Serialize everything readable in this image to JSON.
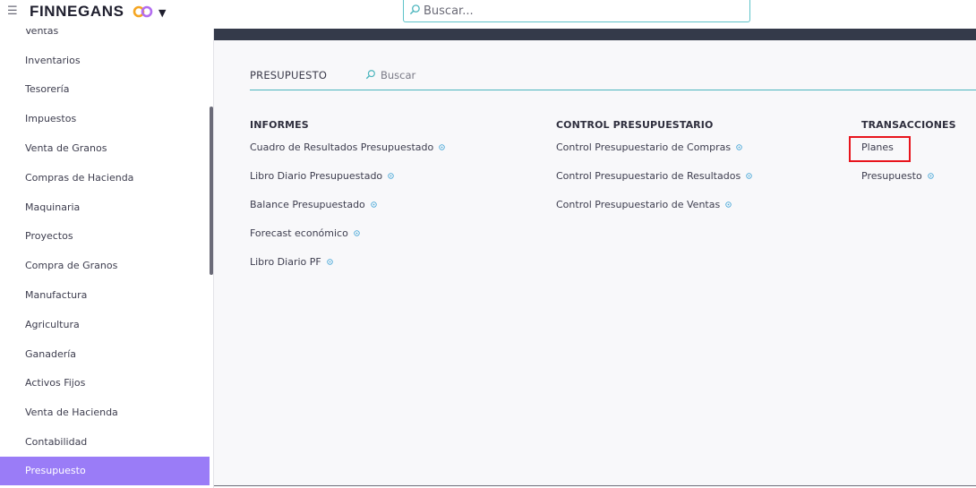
{
  "header": {
    "brand": "FINNEGANS",
    "brand_logo_colors": [
      "#f5a623",
      "#b36ef0"
    ],
    "search_placeholder": "Buscar..."
  },
  "sidebar": {
    "items": [
      {
        "label": "Ventas",
        "active": false
      },
      {
        "label": "Inventarios",
        "active": false
      },
      {
        "label": "Tesorería",
        "active": false
      },
      {
        "label": "Impuestos",
        "active": false
      },
      {
        "label": "Venta de Granos",
        "active": false
      },
      {
        "label": "Compras de Hacienda",
        "active": false
      },
      {
        "label": "Maquinaria",
        "active": false
      },
      {
        "label": "Proyectos",
        "active": false
      },
      {
        "label": "Compra de Granos",
        "active": false
      },
      {
        "label": "Manufactura",
        "active": false
      },
      {
        "label": "Agricultura",
        "active": false
      },
      {
        "label": "Ganadería",
        "active": false
      },
      {
        "label": "Activos Fijos",
        "active": false
      },
      {
        "label": "Venta de Hacienda",
        "active": false
      },
      {
        "label": "Contabilidad",
        "active": false
      },
      {
        "label": "Presupuesto",
        "active": true
      }
    ],
    "active_color": "#9a7cf7"
  },
  "module": {
    "title": "PRESUPUESTO",
    "search_placeholder": "Buscar"
  },
  "sections": {
    "informes": {
      "title": "INFORMES",
      "links": [
        "Cuadro de Resultados Presupuestado",
        "Libro Diario Presupuestado",
        "Balance Presupuestado",
        "Forecast económico",
        "Libro Diario PF"
      ]
    },
    "control": {
      "title": "CONTROL PRESUPUESTARIO",
      "links": [
        "Control Presupuestario de Compras",
        "Control Presupuestario de Resultados",
        "Control Presupuestario de Ventas"
      ]
    },
    "transacciones": {
      "title": "TRANSACCIONES",
      "links": [
        "Planes",
        "Presupuesto"
      ]
    }
  },
  "colors": {
    "accent": "#4bb5bd",
    "dark_bar": "#343a4a",
    "highlight": "#e8141c"
  }
}
